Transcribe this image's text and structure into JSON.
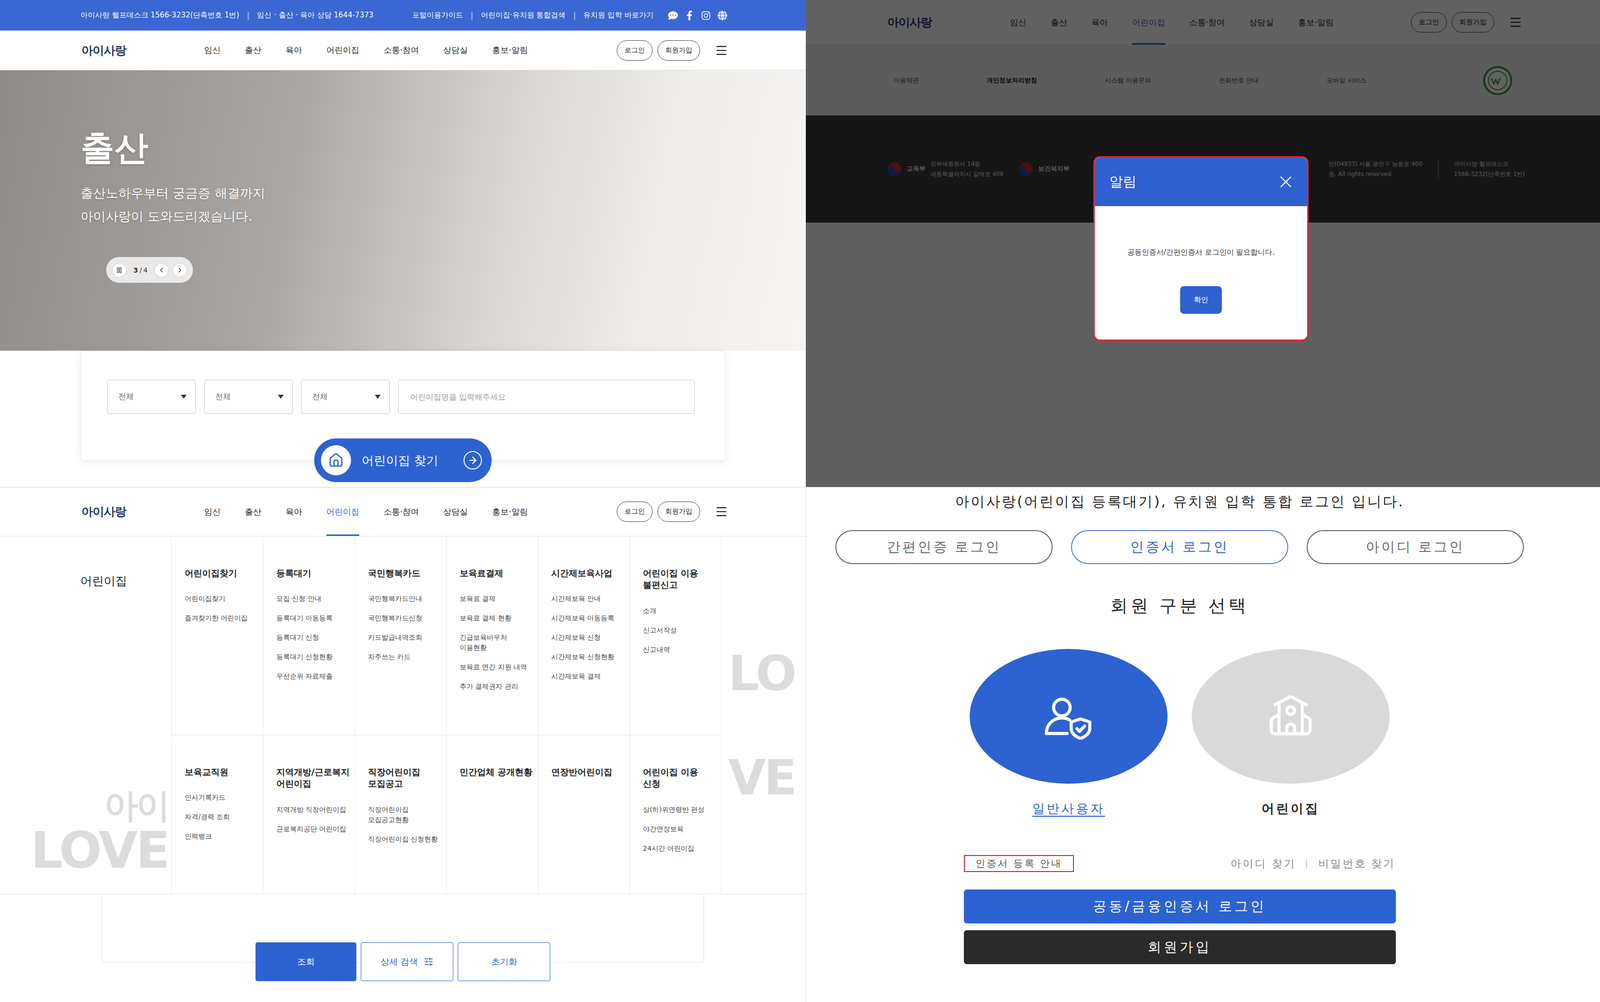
{
  "portal_home": {
    "top_bar": {
      "info": [
        "아이사랑 헬프데스크 1566-3232(단축번호 1번)",
        "임신 · 출산 · 육아 상담 1644-7373"
      ],
      "separator": "|",
      "links": [
        "포털이용가이드",
        "어린이집·유치원 통합검색",
        "유치원 입학 바로가기"
      ]
    },
    "header": {
      "logo": "아이사랑",
      "nav": [
        {
          "label": "임신",
          "selected": false
        },
        {
          "label": "출산",
          "selected": false
        },
        {
          "label": "육아",
          "selected": false
        },
        {
          "label": "어린이집",
          "selected": false
        },
        {
          "label": "소통·참여",
          "selected": false
        },
        {
          "label": "상담실",
          "selected": false
        },
        {
          "label": "홍보·알림",
          "selected": false
        }
      ],
      "buttons": [
        "로그인",
        "회원가입"
      ]
    },
    "hero": {
      "title": "출산",
      "subtitle": [
        "출산노하우부터 궁금증 해결까지",
        "아이사랑이 도와드리겠습니다."
      ],
      "pager": {
        "current": "3",
        "separator": "/",
        "total": "4",
        "playing": true
      }
    },
    "search": {
      "selects": [
        "전체",
        "전체",
        "전체"
      ],
      "placeholder": "어린이집명을 입력해주세요",
      "button": "어린이집 찾기"
    }
  },
  "notice_page": {
    "header": {
      "logo": "아이사랑",
      "nav": [
        {
          "label": "임신",
          "selected": false
        },
        {
          "label": "출산",
          "selected": false
        },
        {
          "label": "육아",
          "selected": false
        },
        {
          "label": "어린이집",
          "selected": true
        },
        {
          "label": "소통·참여",
          "selected": false
        },
        {
          "label": "상담실",
          "selected": false
        },
        {
          "label": "홍보·알림",
          "selected": false
        }
      ],
      "buttons": [
        "로그인",
        "회원가입"
      ]
    },
    "footer_links": [
      {
        "label": "이용약관",
        "emphasis": false
      },
      {
        "label": "개인정보처리방침",
        "emphasis": true
      },
      {
        "label": "시스템 이용문의",
        "emphasis": false
      },
      {
        "label": "전화번호 안내",
        "emphasis": false
      },
      {
        "label": "모바일 서비스",
        "emphasis": false
      }
    ],
    "footer": {
      "agencies": [
        {
          "name": "교육부",
          "address": [
            "정부세종청사 14동",
            "세종특별자치시 갈매로 408"
          ]
        },
        {
          "name": "보건복지부",
          "address": []
        }
      ],
      "address_tail": [
        "인(04933) 서울 광진구 능동로 400",
        "원. All rights reserved."
      ],
      "helpdesk": [
        "아이사랑 헬프데스크",
        "1566-3232(단축번호 1번)"
      ]
    },
    "modal": {
      "title": "알림",
      "message": "공동인증서/간편인증서 로그인이 필요합니다.",
      "button": "확인"
    }
  },
  "menu_page": {
    "header": {
      "logo": "아이사랑",
      "nav": [
        {
          "label": "임신",
          "selected": false
        },
        {
          "label": "출산",
          "selected": false
        },
        {
          "label": "육아",
          "selected": false
        },
        {
          "label": "어린이집",
          "selected": true
        },
        {
          "label": "소통·참여",
          "selected": false
        },
        {
          "label": "상담실",
          "selected": false
        },
        {
          "label": "홍보·알림",
          "selected": false
        }
      ],
      "buttons": [
        "로그인",
        "회원가입"
      ]
    },
    "menu_title": "어린이집",
    "sections": [
      {
        "title": "어린이집찾기",
        "items": [
          "어린이집찾기",
          "즐겨찾기한 어린이집"
        ]
      },
      {
        "title": "등록대기",
        "items": [
          "모집·신청 안내",
          "등록대기 아동등록",
          "등록대기 신청",
          "등록대기 신청현황",
          "우선순위 자료제출"
        ]
      },
      {
        "title": "국민행복카드",
        "items": [
          "국민행복카드안내",
          "국민행복카드신청",
          "카드발급내역조회",
          "자주쓰는 카드"
        ]
      },
      {
        "title": "보육료결제",
        "items": [
          "보육료 결제",
          "보육료 결제 현황",
          "긴급보육바우처 이용현황",
          "보육료 연간 지원 내역",
          "추가 결제권자 관리"
        ]
      },
      {
        "title": "시간제보육사업",
        "items": [
          "시간제보육 안내",
          "시간제보육 아동등록",
          "시간제보육 신청",
          "시간제보육 신청현황",
          "시간제보육 결제"
        ]
      },
      {
        "title": "어린이집 이용 불편신고",
        "items": [
          "소개",
          "신고서작성",
          "신고내역"
        ]
      },
      {
        "title": "보육교직원",
        "items": [
          "인사기록카드",
          "자격/경력 조회",
          "인력뱅크"
        ]
      },
      {
        "title": "지역개방/근로복지 어린이집",
        "items": [
          "지역개방 직장어린이집",
          "근로복지공단 어린이집"
        ]
      },
      {
        "title": "직장어린이집 모집공고",
        "items": [
          "직장어린이집 모집공고현황",
          "직장어린이집 신청현황"
        ]
      },
      {
        "title": "민간업체 공개현황",
        "items": []
      },
      {
        "title": "연장반어린이집",
        "items": []
      },
      {
        "title": "어린이집 이용 신청",
        "items": [
          "상(하)위연령반 편성",
          "야간연장보육",
          "24시간 어린이집"
        ]
      }
    ],
    "watermark_left": [
      "아이",
      "LOVE"
    ],
    "watermark_right": [
      "LO",
      "VE"
    ],
    "buttons": [
      {
        "label": "조회",
        "kind": "primary"
      },
      {
        "label": "상세 검색",
        "kind": "filter"
      },
      {
        "label": "초기화",
        "kind": "outline"
      }
    ]
  },
  "login_page": {
    "title": "아이사랑(어린이집 등록대기), 유치원 입학 통합 로그인 입니다.",
    "tabs": [
      {
        "label": "간편인증 로그인",
        "selected": false
      },
      {
        "label": "인증서 로그인",
        "selected": true
      },
      {
        "label": "아이디 로그인",
        "selected": false
      }
    ],
    "heading": "회원 구분 선택",
    "member_types": [
      {
        "label": "일반사용자",
        "kind": "user",
        "selected": true
      },
      {
        "label": "어린이집",
        "kind": "daycare",
        "selected": false
      }
    ],
    "register_guide": "인증서 등록 안내",
    "find_links": [
      "아이디 찾기",
      "비밀번호 찾기"
    ],
    "find_separator": "|",
    "login_button": "공동/금융인증서 로그인",
    "join_button": "회원가입"
  }
}
